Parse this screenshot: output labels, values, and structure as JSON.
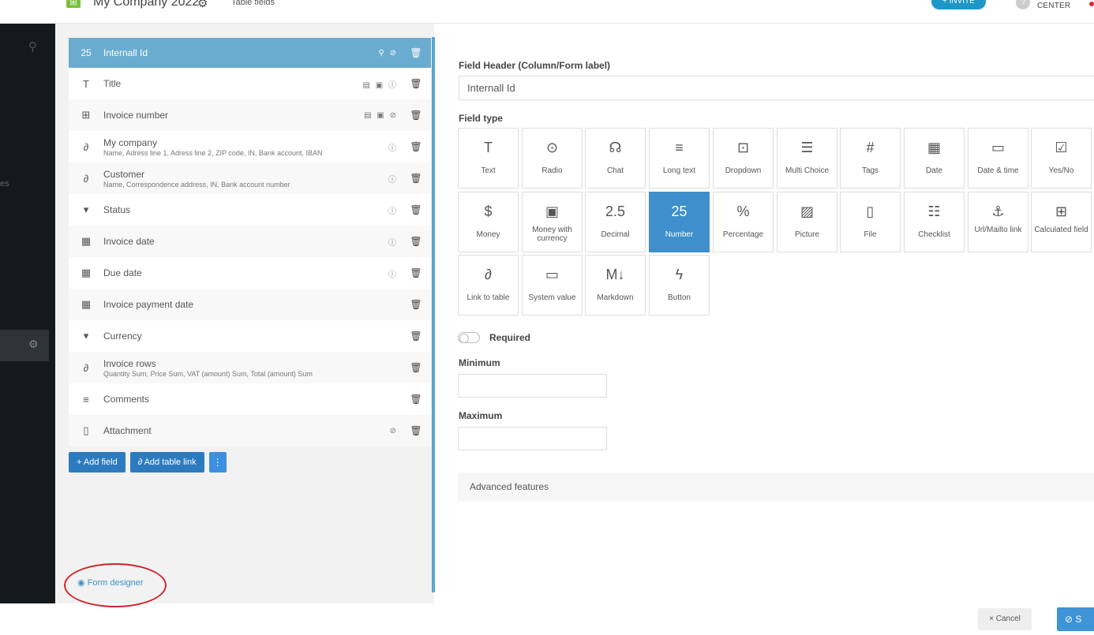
{
  "topbar": {
    "app_name": "My Company 2022",
    "breadcrumb": "Table fields",
    "invite_label": "+ INVITE",
    "help_label": "CENTER"
  },
  "sidebar": {
    "label_fragment": "es"
  },
  "fields": [
    {
      "icon": "25",
      "name": "Internall Id",
      "sub": "",
      "flags": "⚲ ⊘",
      "active": true
    },
    {
      "icon": "T",
      "name": "Title",
      "sub": "",
      "flags": "▤ ▣ ⓘ"
    },
    {
      "icon": "⊞",
      "name": "Invoice number",
      "sub": "",
      "flags": "▤ ▣ ⊘"
    },
    {
      "icon": "∂",
      "name": "My company",
      "sub": "Name, Adress line 1, Adress line 2, ZIP code, IN, Bank account, IBAN",
      "flags": "ⓘ"
    },
    {
      "icon": "∂",
      "name": "Customer",
      "sub": "Name, Correspondence address, IN, Bank account number",
      "flags": "ⓘ"
    },
    {
      "icon": "▾",
      "name": "Status",
      "sub": "",
      "flags": "ⓘ"
    },
    {
      "icon": "▦",
      "name": "Invoice date",
      "sub": "",
      "flags": "ⓘ"
    },
    {
      "icon": "▦",
      "name": "Due date",
      "sub": "",
      "flags": "ⓘ"
    },
    {
      "icon": "▦",
      "name": "Invoice payment date",
      "sub": "",
      "flags": ""
    },
    {
      "icon": "▾",
      "name": "Currency",
      "sub": "",
      "flags": ""
    },
    {
      "icon": "∂",
      "name": "Invoice rows",
      "sub": "Quantity Sum, Price Sum, VAT (amount) Sum, Total (amount) Sum",
      "flags": ""
    },
    {
      "icon": "≡",
      "name": "Comments",
      "sub": "",
      "flags": ""
    },
    {
      "icon": "▯",
      "name": "Attachment",
      "sub": "",
      "flags": "⊘"
    }
  ],
  "list_actions": {
    "add_field": "+ Add field",
    "add_table_link": "∂ Add table link",
    "more": "⋮"
  },
  "form_designer": "◉ Form designer",
  "editor": {
    "header_label": "Field Header (Column/Form label)",
    "header_value": "Internall Id",
    "type_label": "Field type",
    "types": [
      {
        "icon": "T",
        "label": "Text"
      },
      {
        "icon": "⊙",
        "label": "Radio"
      },
      {
        "icon": "☊",
        "label": "Chat"
      },
      {
        "icon": "≡",
        "label": "Long text"
      },
      {
        "icon": "⊡",
        "label": "Dropdown"
      },
      {
        "icon": "☰",
        "label": "Multi Choice"
      },
      {
        "icon": "#",
        "label": "Tags"
      },
      {
        "icon": "▦",
        "label": "Date"
      },
      {
        "icon": "▭",
        "label": "Date & time"
      },
      {
        "icon": "☑",
        "label": "Yes/No"
      },
      {
        "icon": "$",
        "label": "Money"
      },
      {
        "icon": "▣",
        "label": "Money with currency"
      },
      {
        "icon": "2.5",
        "label": "Decimal"
      },
      {
        "icon": "25",
        "label": "Number",
        "selected": true
      },
      {
        "icon": "%",
        "label": "Percentage"
      },
      {
        "icon": "▨",
        "label": "Picture"
      },
      {
        "icon": "▯",
        "label": "File"
      },
      {
        "icon": "☷",
        "label": "Checklist"
      },
      {
        "icon": "⚓",
        "label": "Url/Mailto link"
      },
      {
        "icon": "⊞",
        "label": "Calculated field"
      },
      {
        "icon": "∂",
        "label": "Link to table"
      },
      {
        "icon": "▭",
        "label": "System value"
      },
      {
        "icon": "M↓",
        "label": "Markdown"
      },
      {
        "icon": "ϟ",
        "label": "Button"
      }
    ],
    "required_label": "Required",
    "minimum_label": "Minimum",
    "maximum_label": "Maximum",
    "advanced_label": "Advanced features"
  },
  "footer": {
    "cancel_label": "× Cancel",
    "save_label": "⊘ S"
  }
}
